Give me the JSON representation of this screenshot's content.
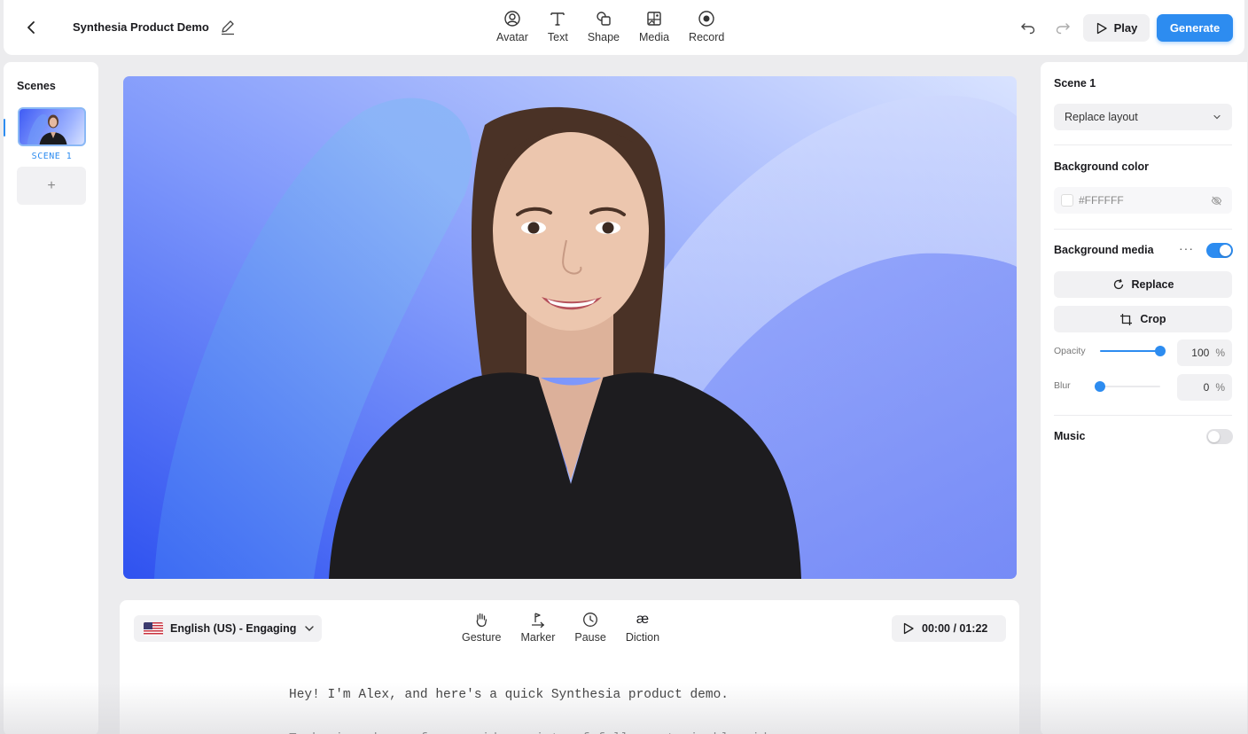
{
  "header": {
    "project_title": "Synthesia Product Demo",
    "tools": [
      {
        "label": "Avatar",
        "icon": "avatar-icon"
      },
      {
        "label": "Text",
        "icon": "text-icon"
      },
      {
        "label": "Shape",
        "icon": "shape-icon"
      },
      {
        "label": "Media",
        "icon": "media-icon"
      },
      {
        "label": "Record",
        "icon": "record-icon"
      }
    ],
    "play_label": "Play",
    "generate_label": "Generate"
  },
  "scenes": {
    "title": "Scenes",
    "items": [
      {
        "label": "SCENE 1",
        "active": true
      }
    ],
    "add_label": "+"
  },
  "script": {
    "voice_label": "English (US) - Engaging",
    "tools": [
      {
        "label": "Gesture",
        "icon": "gesture-icon"
      },
      {
        "label": "Marker",
        "icon": "marker-icon"
      },
      {
        "label": "Pause",
        "icon": "pause-icon"
      },
      {
        "label": "Diction",
        "icon": "diction-icon"
      }
    ],
    "timer": "00:00 / 01:22",
    "lines": [
      "Hey! I'm Alex, and here's a quick Synthesia product demo.",
      "To begin, choose from a wide variety of fully customizable video"
    ]
  },
  "properties": {
    "scene_title": "Scene 1",
    "layout_select": "Replace layout",
    "bg_color_title": "Background color",
    "bg_color_value": "#FFFFFF",
    "bg_media_title": "Background media",
    "bg_media_enabled": true,
    "replace_label": "Replace",
    "crop_label": "Crop",
    "opacity_label": "Opacity",
    "opacity_value": "100",
    "opacity_fraction": 1.0,
    "blur_label": "Blur",
    "blur_value": "0",
    "blur_fraction": 0.0,
    "percent_unit": "%",
    "music_title": "Music",
    "music_enabled": false
  },
  "colors": {
    "accent": "#2d8cf0",
    "canvas_gradient_start": "#2f52f0",
    "canvas_gradient_end": "#c9d6ff"
  }
}
